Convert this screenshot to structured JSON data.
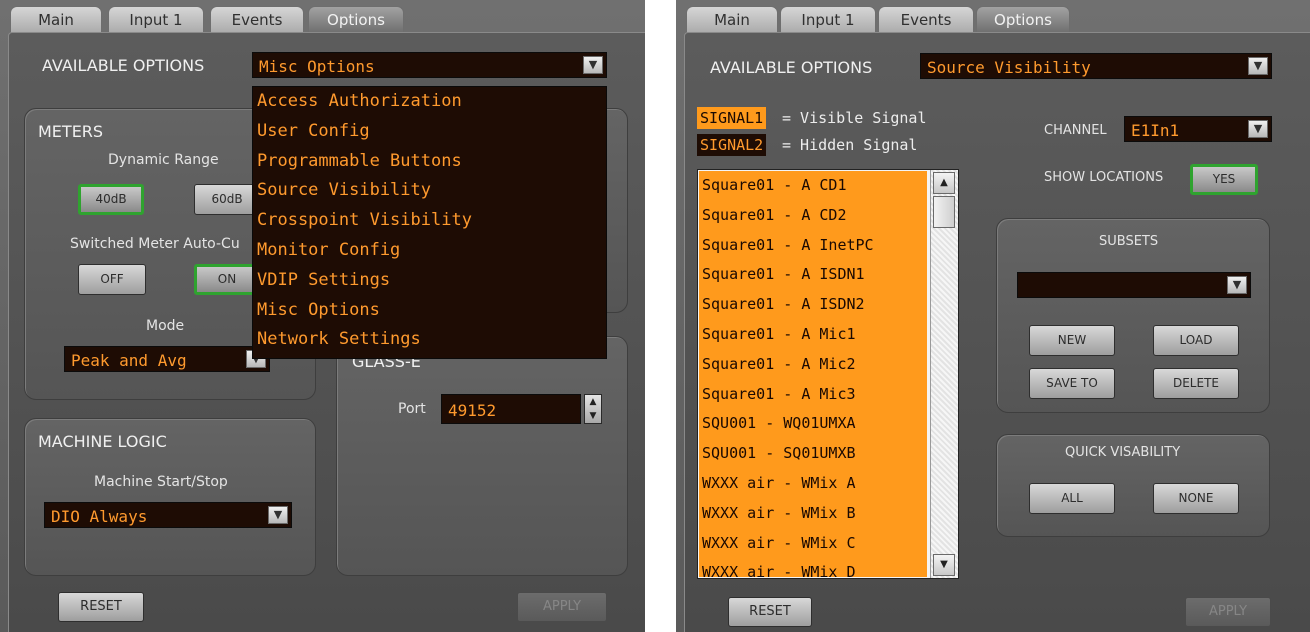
{
  "left": {
    "tabs": [
      "Main",
      "Input 1",
      "Events",
      "Options"
    ],
    "available_options_label": "AVAILABLE OPTIONS",
    "options_selected": "Misc Options",
    "options_menu": [
      "Access Authorization",
      "User Config",
      "Programmable Buttons",
      "Source Visibility",
      "Crosspoint Visibility",
      "Monitor Config",
      "VDIP Settings",
      "Misc Options",
      "Network Settings"
    ],
    "meters": {
      "title": "METERS",
      "dynamic_range_label": "Dynamic Range",
      "range_40": "40dB",
      "range_60": "60dB",
      "switched_meter_label": "Switched Meter Auto-Cu",
      "off_label": "OFF",
      "on_label": "ON",
      "mode_label": "Mode",
      "mode_value": "Peak and Avg"
    },
    "machine_logic": {
      "title": "MACHINE LOGIC",
      "start_stop_label": "Machine Start/Stop",
      "start_stop_value": "DIO Always"
    },
    "glass": {
      "title": "GLASS-E",
      "port_label": "Port",
      "port_value": "49152"
    },
    "reset_label": "RESET",
    "apply_label": "APPLY"
  },
  "right": {
    "tabs": [
      "Main",
      "Input 1",
      "Events",
      "Options"
    ],
    "available_options_label": "AVAILABLE OPTIONS",
    "options_selected": "Source Visibility",
    "legend": {
      "visible_tag": "SIGNAL1",
      "visible_text": "= Visible Signal",
      "hidden_tag": "SIGNAL2",
      "hidden_text": "= Hidden Signal"
    },
    "sources": [
      "Square01 - A CD1",
      "Square01 - A CD2",
      "Square01 - A InetPC",
      "Square01 - A ISDN1",
      "Square01 - A ISDN2",
      "Square01 - A Mic1",
      "Square01 - A Mic2",
      "Square01 - A Mic3",
      "SQU001 - WQ01UMXA",
      "SQU001 - SQ01UMXB",
      "WXXX air - WMix A",
      "WXXX air - WMix B",
      "WXXX air - WMix C",
      "WXXX air - WMix D"
    ],
    "channel_label": "CHANNEL",
    "channel_value": "E1In1",
    "show_locations_label": "SHOW LOCATIONS",
    "show_locations_value": "YES",
    "subsets": {
      "title": "SUBSETS",
      "selected": "",
      "new_label": "NEW",
      "load_label": "LOAD",
      "save_to_label": "SAVE TO",
      "delete_label": "DELETE"
    },
    "quick_visibility": {
      "title": "QUICK VISABILITY",
      "all_label": "ALL",
      "none_label": "NONE"
    },
    "reset_label": "RESET",
    "apply_label": "APPLY"
  },
  "colors": {
    "accent_text": "#ff9a2e",
    "visible_signal": "#ff9a1c",
    "hidden_signal": "#1e0c04",
    "selected_border": "#2fa32f"
  }
}
